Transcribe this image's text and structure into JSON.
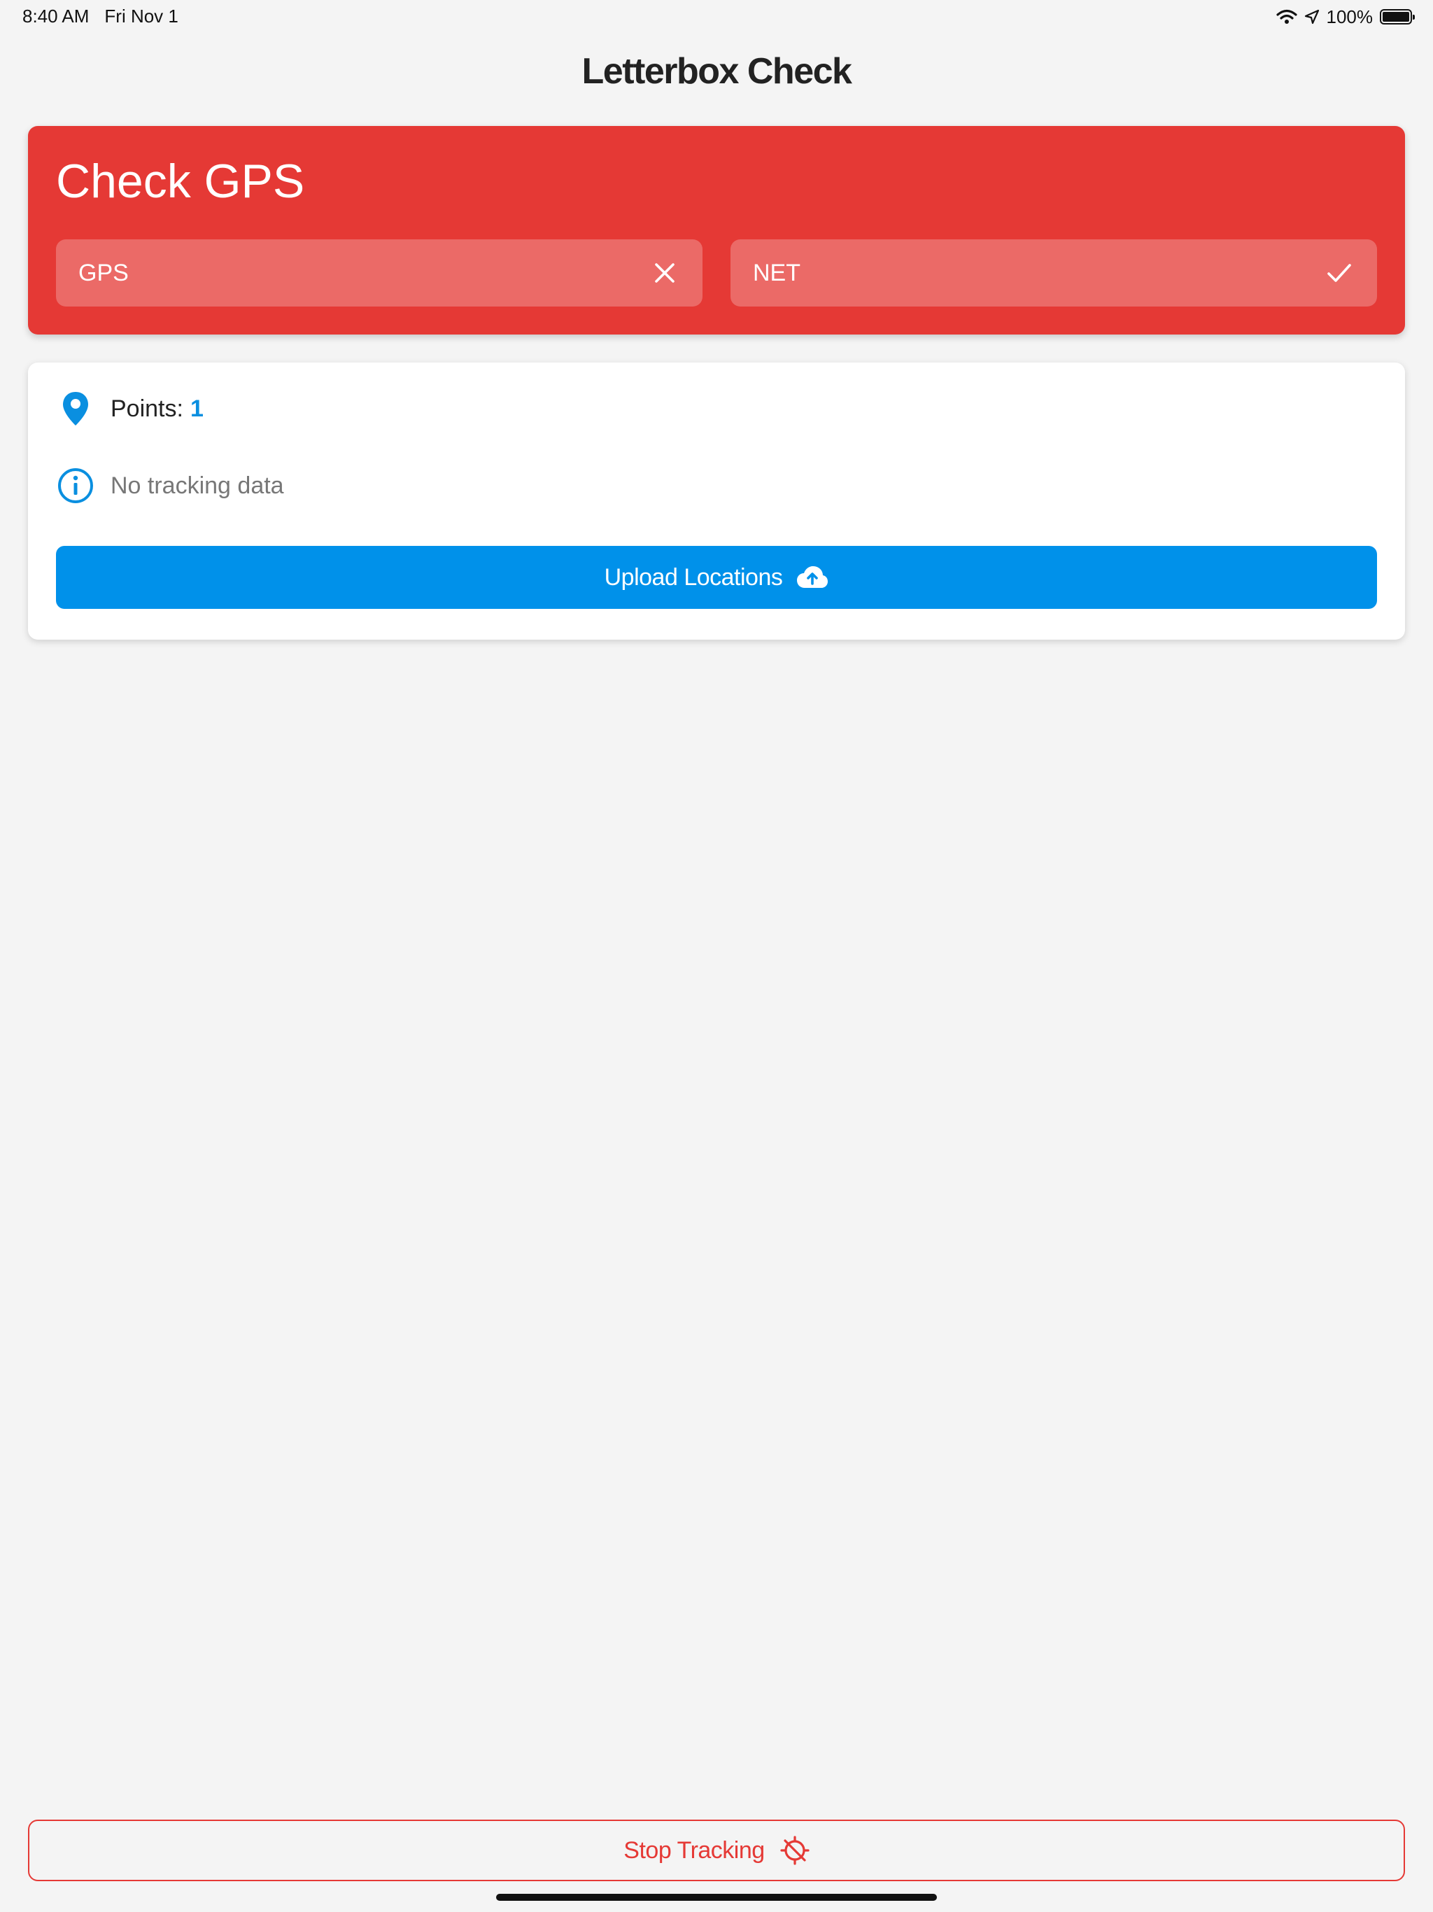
{
  "status_bar": {
    "time": "8:40 AM",
    "date": "Fri Nov 1",
    "battery_text": "100%",
    "battery_level": 1.0,
    "icons": [
      "wifi-icon",
      "location-arrow-icon",
      "battery-icon"
    ]
  },
  "app": {
    "title": "Letterbox Check"
  },
  "check_card": {
    "title": "Check GPS",
    "background_color": "#e53935",
    "gps": {
      "label": "GPS",
      "status": "fail",
      "icon": "close-icon"
    },
    "net": {
      "label": "NET",
      "status": "ok",
      "icon": "check-icon"
    }
  },
  "info_card": {
    "points_label": "Points:",
    "points_value": "1",
    "points_icon": "map-pin-icon",
    "tracking_text": "No tracking data",
    "tracking_icon": "info-icon",
    "upload_button": {
      "label": "Upload Locations",
      "icon": "cloud-upload-icon",
      "color": "#0091ea"
    }
  },
  "stop_button": {
    "label": "Stop Tracking",
    "icon": "crosshair-off-icon",
    "color": "#e53935"
  }
}
